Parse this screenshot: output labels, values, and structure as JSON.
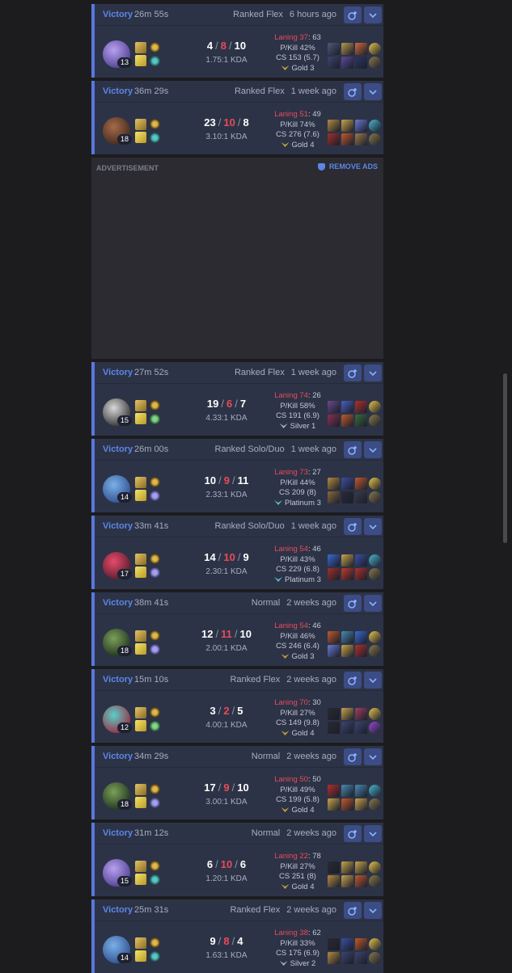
{
  "ad": {
    "label": "ADVERTISEMENT",
    "remove_label": "REMOVE ADS"
  },
  "colors": {
    "card_bg": "#2d3347",
    "accent": "#5878e0",
    "victory": "#5b86e8",
    "death": "#ea4a58",
    "button": "#3c4c84"
  },
  "matches": [
    {
      "result": "Victory",
      "duration": "26m 55s",
      "queue": "Ranked Flex",
      "time": "6 hours ago",
      "level": "13",
      "kills": "4",
      "deaths": "8",
      "assists": "10",
      "kda": "1.75:1 KDA",
      "laning": "Laning 37",
      "laning_vs": ": 63",
      "pkill": "P/Kill 42%",
      "cs": "CS 153 (5.7)",
      "rank": "Gold 3",
      "rank_color": "#c9a13a",
      "champ_colors": [
        "#b8a0f0",
        "#4a3a8a"
      ],
      "rune2": "teal",
      "items": [
        "#4f5a78",
        "#b59a4d",
        "#d06a3a",
        "#e9c44a",
        "#3c4570",
        "#5e4a9a",
        "#2e3560",
        "#8a7a4a"
      ]
    },
    {
      "result": "Victory",
      "duration": "36m 29s",
      "queue": "Ranked Flex",
      "time": "1 week ago",
      "level": "18",
      "kills": "23",
      "deaths": "10",
      "assists": "8",
      "kda": "3.10:1 KDA",
      "laning": "Laning 51",
      "laning_vs": ": 49",
      "pkill": "P/Kill 74%",
      "cs": "CS 276 (7.6)",
      "rank": "Gold 4",
      "rank_color": "#c9a13a",
      "champ_colors": [
        "#a66a4a",
        "#3a241a"
      ],
      "rune2": "teal",
      "items": [
        "#b58a3d",
        "#c9a44a",
        "#6a7ad0",
        "#4ab8d0",
        "#a0302a",
        "#c05a2a",
        "#9a7a4a",
        "#8a7a4a"
      ]
    },
    {
      "result": "Victory",
      "duration": "27m 52s",
      "queue": "Ranked Flex",
      "time": "1 week ago",
      "level": "15",
      "kills": "19",
      "deaths": "6",
      "assists": "7",
      "kda": "4.33:1 KDA",
      "laning": "Laning 74",
      "laning_vs": ": 26",
      "pkill": "P/Kill 58%",
      "cs": "CS 191 (6.9)",
      "rank": "Silver 1",
      "rank_color": "#9fb0c0",
      "champ_colors": [
        "#d8d8d8",
        "#2a2a2a"
      ],
      "rune2": "green",
      "items": [
        "#6a4a8a",
        "#4a60c0",
        "#b0302a",
        "#e9c44a",
        "#8a3050",
        "#c05a2a",
        "#3a6a3a",
        "#8a7a4a"
      ]
    },
    {
      "result": "Victory",
      "duration": "26m 00s",
      "queue": "Ranked Solo/Duo",
      "time": "1 week ago",
      "level": "14",
      "kills": "10",
      "deaths": "9",
      "assists": "11",
      "kda": "2.33:1 KDA",
      "laning": "Laning 73",
      "laning_vs": ": 27",
      "pkill": "P/Kill 44%",
      "cs": "CS 209 (8)",
      "rank": "Platinum 3",
      "rank_color": "#5ab8d0",
      "champ_colors": [
        "#7ab0e8",
        "#2a4a8a"
      ],
      "rune2": "violet",
      "items": [
        "#b58a3d",
        "#3a50a0",
        "#c05a2a",
        "#e9c44a",
        "#8a6a3a",
        "#2a2a3a",
        "#3a3a4a",
        "#8a7a4a"
      ]
    },
    {
      "result": "Victory",
      "duration": "33m 41s",
      "queue": "Ranked Solo/Duo",
      "time": "1 week ago",
      "level": "17",
      "kills": "14",
      "deaths": "10",
      "assists": "9",
      "kda": "2.30:1 KDA",
      "laning": "Laning 54",
      "laning_vs": ": 46",
      "pkill": "P/Kill 43%",
      "cs": "CS 229 (6.8)",
      "rank": "Platinum 3",
      "rank_color": "#5ab8d0",
      "champ_colors": [
        "#e84a6a",
        "#4a1a2a"
      ],
      "rune2": "violet",
      "items": [
        "#3a6ad0",
        "#c9a44a",
        "#3a50a0",
        "#4ab8d0",
        "#a0302a",
        "#c03a2a",
        "#b0302a",
        "#8a7a4a"
      ]
    },
    {
      "result": "Victory",
      "duration": "38m 41s",
      "queue": "Normal",
      "time": "2 weeks ago",
      "level": "18",
      "kills": "12",
      "deaths": "11",
      "assists": "10",
      "kda": "2.00:1 KDA",
      "laning": "Laning 54",
      "laning_vs": ": 46",
      "pkill": "P/Kill 46%",
      "cs": "CS 246 (6.4)",
      "rank": "Gold 3",
      "rank_color": "#c9a13a",
      "champ_colors": [
        "#7aa05a",
        "#1a2a1a"
      ],
      "rune2": "violet",
      "items": [
        "#c05a2a",
        "#4a8ab0",
        "#3a6ad0",
        "#e9c44a",
        "#6a7ad0",
        "#c9a44a",
        "#b0302a",
        "#8a7a4a"
      ]
    },
    {
      "result": "Victory",
      "duration": "15m 10s",
      "queue": "Ranked Flex",
      "time": "2 weeks ago",
      "level": "12",
      "kills": "3",
      "deaths": "2",
      "assists": "5",
      "kda": "4.00:1 KDA",
      "laning": "Laning 70",
      "laning_vs": ": 30",
      "pkill": "P/Kill 27%",
      "cs": "CS 149 (9.8)",
      "rank": "Gold 4",
      "rank_color": "#c9a13a",
      "champ_colors": [
        "#5ad0c8",
        "#a0203a"
      ],
      "rune2": "green",
      "items": [
        "#2a2a30",
        "#c9a44a",
        "#a04060",
        "#e9c44a",
        "#2a2a30",
        "#3c4570",
        "#3c4570",
        "#9a4ad0"
      ]
    },
    {
      "result": "Victory",
      "duration": "34m 29s",
      "queue": "Normal",
      "time": "2 weeks ago",
      "level": "18",
      "kills": "17",
      "deaths": "9",
      "assists": "10",
      "kda": "3.00:1 KDA",
      "laning": "Laning 50",
      "laning_vs": ": 50",
      "pkill": "P/Kill 49%",
      "cs": "CS 199 (5.8)",
      "rank": "Gold 4",
      "rank_color": "#c9a13a",
      "champ_colors": [
        "#7aa05a",
        "#1a2a1a"
      ],
      "rune2": "violet",
      "items": [
        "#b0302a",
        "#4a8ab0",
        "#4a8ab0",
        "#4ab8d0",
        "#c9a44a",
        "#c05a2a",
        "#c9a44a",
        "#8a7a4a"
      ]
    },
    {
      "result": "Victory",
      "duration": "31m 12s",
      "queue": "Normal",
      "time": "2 weeks ago",
      "level": "15",
      "kills": "6",
      "deaths": "10",
      "assists": "6",
      "kda": "1.20:1 KDA",
      "laning": "Laning 22",
      "laning_vs": ": 78",
      "pkill": "P/Kill 27%",
      "cs": "CS 251 (8)",
      "rank": "Gold 4",
      "rank_color": "#c9a13a",
      "champ_colors": [
        "#b8a0f0",
        "#4a3a8a"
      ],
      "rune2": "teal",
      "items": [
        "#2a2a30",
        "#c9a44a",
        "#c9a44a",
        "#e9c44a",
        "#b58a3d",
        "#c9a44a",
        "#c05a2a",
        "#8a7a4a"
      ]
    },
    {
      "result": "Victory",
      "duration": "25m 31s",
      "queue": "Ranked Flex",
      "time": "2 weeks ago",
      "level": "14",
      "kills": "9",
      "deaths": "8",
      "assists": "4",
      "kda": "1.63:1 KDA",
      "laning": "Laning 38",
      "laning_vs": ": 62",
      "pkill": "P/Kill 33%",
      "cs": "CS 175 (6.9)",
      "rank": "Silver 2",
      "rank_color": "#9fb0c0",
      "champ_colors": [
        "#7ab0e8",
        "#2a4a8a"
      ],
      "rune2": "teal",
      "items": [
        "#2a2a30",
        "#3a50a0",
        "#c05a2a",
        "#e9c44a",
        "#b58a3d",
        "#3c4570",
        "#3c4570",
        "#8a7a4a"
      ]
    }
  ]
}
